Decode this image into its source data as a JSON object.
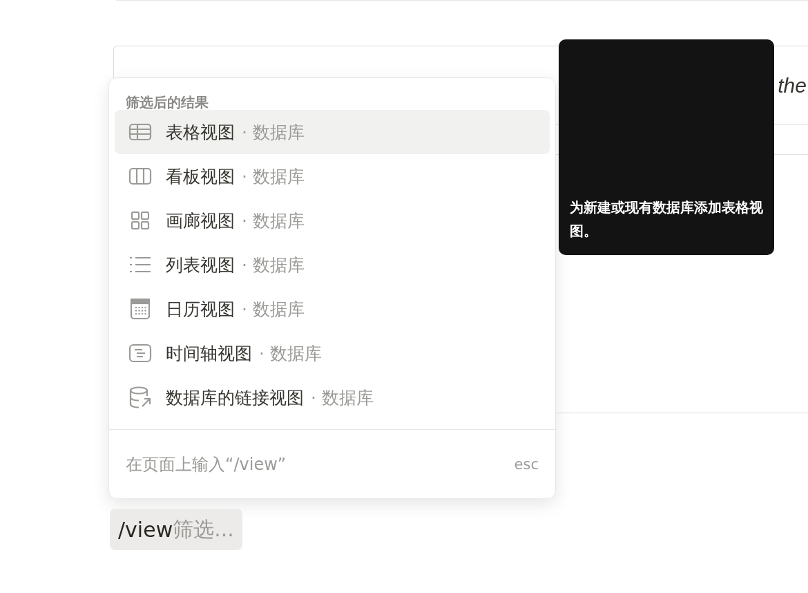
{
  "page_block": {
    "text": "the"
  },
  "menu": {
    "heading": "筛选后的结果",
    "items": [
      {
        "kind": "table",
        "label": "表格视图",
        "suffix": "· 数据库",
        "selected": true
      },
      {
        "kind": "board",
        "label": "看板视图",
        "suffix": "· 数据库",
        "selected": false
      },
      {
        "kind": "gallery",
        "label": "画廊视图",
        "suffix": "· 数据库",
        "selected": false
      },
      {
        "kind": "list",
        "label": "列表视图",
        "suffix": "· 数据库",
        "selected": false
      },
      {
        "kind": "calendar",
        "label": "日历视图",
        "suffix": "· 数据库",
        "selected": false
      },
      {
        "kind": "timeline",
        "label": "时间轴视图",
        "suffix": "· 数据库",
        "selected": false
      },
      {
        "kind": "linked",
        "label": "数据库的链接视图",
        "suffix": "· 数据库",
        "selected": false
      }
    ],
    "footer_hint": "在页面上输入“/view”",
    "footer_key": "esc"
  },
  "tooltip": {
    "text": "为新建或现有数据库添加表格视图。"
  },
  "command_input": {
    "value": "/view",
    "placeholder": "筛选..."
  }
}
